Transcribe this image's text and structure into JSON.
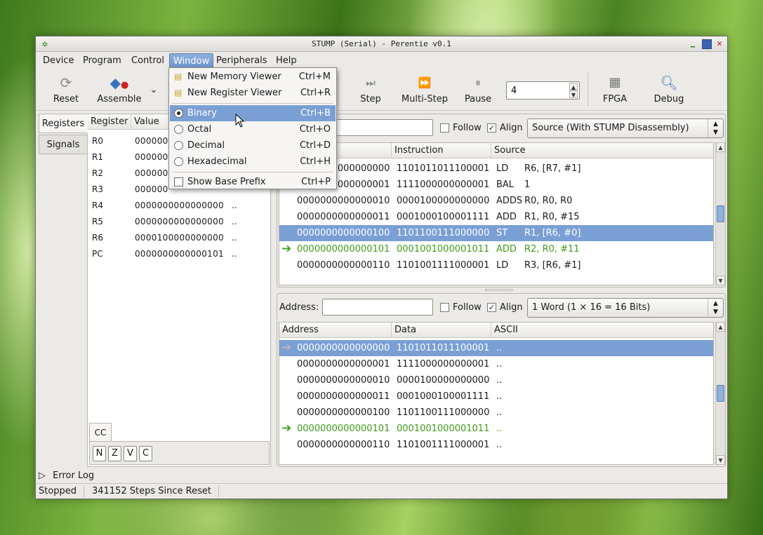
{
  "window": {
    "title": "STUMP (Serial) - Perentie v0.1"
  },
  "menubar": [
    "Device",
    "Program",
    "Control",
    "Window",
    "Peripherals",
    "Help"
  ],
  "toolbar": {
    "reset": "Reset",
    "assemble": "Assemble",
    "step": "Step",
    "multistep": "Multi-Step",
    "pause": "Pause",
    "steps_value": "4",
    "fpga": "FPGA",
    "debug": "Debug"
  },
  "window_menu": {
    "items": [
      {
        "label": "New Memory Viewer",
        "shortcut": "Ctrl+M",
        "type": "icon"
      },
      {
        "label": "New Register Viewer",
        "shortcut": "Ctrl+R",
        "type": "icon"
      },
      {
        "label": "Binary",
        "shortcut": "Ctrl+B",
        "type": "radio",
        "checked": true
      },
      {
        "label": "Octal",
        "shortcut": "Ctrl+O",
        "type": "radio",
        "checked": false
      },
      {
        "label": "Decimal",
        "shortcut": "Ctrl+D",
        "type": "radio",
        "checked": false
      },
      {
        "label": "Hexadecimal",
        "shortcut": "Ctrl+H",
        "type": "radio",
        "checked": false
      },
      {
        "label": "Show Base Prefix",
        "shortcut": "Ctrl+P",
        "type": "check",
        "checked": false
      }
    ]
  },
  "side_tabs": [
    "Registers",
    "Signals"
  ],
  "registers": {
    "headers": [
      "Register",
      "Value"
    ],
    "rows": [
      {
        "name": "R0",
        "value": "000000",
        "dots": ""
      },
      {
        "name": "R1",
        "value": "000000",
        "dots": ""
      },
      {
        "name": "R2",
        "value": "000000",
        "dots": ""
      },
      {
        "name": "R3",
        "value": "000000",
        "dots": ""
      },
      {
        "name": "R4",
        "value": "0000000000000000",
        "dots": ".."
      },
      {
        "name": "R5",
        "value": "0000000000000000",
        "dots": ".."
      },
      {
        "name": "R6",
        "value": "0000100000000000",
        "dots": ".."
      },
      {
        "name": "PC",
        "value": "0000000000000101",
        "dots": ".."
      }
    ],
    "cc_tab": "CC",
    "flags": [
      "N",
      "Z",
      "V",
      "C"
    ]
  },
  "disasm": {
    "follow": "Follow",
    "follow_checked": false,
    "align": "Align",
    "align_checked": true,
    "view": "Source (With STUMP Disassembly)",
    "headers": [
      "Instruction",
      "Source"
    ],
    "rows": [
      {
        "addr": "0000000000000000",
        "instr": "1101011011100001",
        "op": "LD",
        "args": "R6, [R7, #1]"
      },
      {
        "addr": "0000000000000001",
        "instr": "1111000000000001",
        "op": "BAL",
        "args": "1"
      },
      {
        "addr": "0000000000000010",
        "instr": "0000100000000000",
        "op": "ADDS",
        "args": "R0, R0, R0"
      },
      {
        "addr": "0000000000000011",
        "instr": "0001000100001111",
        "op": "ADD",
        "args": "R1, R0, #15"
      },
      {
        "addr": "0000000000000100",
        "instr": "1101100111000000",
        "op": "ST",
        "args": "R1, [R6, #0]"
      },
      {
        "addr": "0000000000000101",
        "instr": "0001001000001011",
        "op": "ADD",
        "args": "R2, R0, #11"
      },
      {
        "addr": "0000000000000110",
        "instr": "1101001111000001",
        "op": "LD",
        "args": "R3, [R6, #1]"
      }
    ]
  },
  "memory": {
    "address_label": "Address:",
    "address_value": "",
    "follow": "Follow",
    "follow_checked": false,
    "align": "Align",
    "align_checked": true,
    "view": "1 Word (1 × 16 = 16 Bits)",
    "headers": [
      "Address",
      "Data",
      "ASCII"
    ],
    "rows": [
      {
        "addr": "0000000000000000",
        "data": "1101011011100001",
        "ascii": ".."
      },
      {
        "addr": "0000000000000001",
        "data": "1111000000000001",
        "ascii": ".."
      },
      {
        "addr": "0000000000000010",
        "data": "0000100000000000",
        "ascii": ".."
      },
      {
        "addr": "0000000000000011",
        "data": "0001000100001111",
        "ascii": ".."
      },
      {
        "addr": "0000000000000100",
        "data": "1101100111000000",
        "ascii": ".."
      },
      {
        "addr": "0000000000000101",
        "data": "0001001000001011",
        "ascii": ".."
      },
      {
        "addr": "0000000000000110",
        "data": "1101001111000001",
        "ascii": ".."
      }
    ]
  },
  "error_log": "Error Log",
  "status": {
    "state": "Stopped",
    "steps": "341152 Steps Since Reset"
  },
  "colors": {
    "selection": "#7a9fd4",
    "current_pc": "#3e9b1a"
  }
}
